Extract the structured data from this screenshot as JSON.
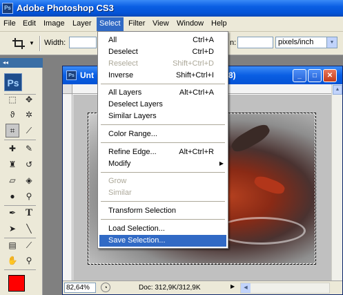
{
  "app": {
    "title": "Adobe Photoshop CS3",
    "ps_badge": "Ps"
  },
  "menubar": {
    "items": [
      "File",
      "Edit",
      "Image",
      "Layer",
      "Select",
      "Filter",
      "View",
      "Window",
      "Help"
    ],
    "active": "Select"
  },
  "options": {
    "width_label": "Width:",
    "res_label_tail": "n:",
    "unit": "pixels/inch"
  },
  "toolbox": {
    "collapse": "◂◂",
    "logo": "Ps",
    "foreground_color": "#ff0000"
  },
  "document": {
    "title_start": "Unt",
    "title_end": "8)",
    "zoom": "82,64%",
    "doc_info": "Doc: 312,9K/312,9K"
  },
  "select_menu": {
    "items": [
      {
        "label": "All",
        "shortcut": "Ctrl+A",
        "disabled": false
      },
      {
        "label": "Deselect",
        "shortcut": "Ctrl+D",
        "disabled": false
      },
      {
        "label": "Reselect",
        "shortcut": "Shift+Ctrl+D",
        "disabled": true
      },
      {
        "label": "Inverse",
        "shortcut": "Shift+Ctrl+I",
        "disabled": false
      },
      {
        "label": "All Layers",
        "shortcut": "Alt+Ctrl+A",
        "disabled": false
      },
      {
        "label": "Deselect Layers",
        "shortcut": "",
        "disabled": false
      },
      {
        "label": "Similar Layers",
        "shortcut": "",
        "disabled": false
      },
      {
        "label": "Color Range...",
        "shortcut": "",
        "disabled": false
      },
      {
        "label": "Refine Edge...",
        "shortcut": "Alt+Ctrl+R",
        "disabled": false
      },
      {
        "label": "Modify",
        "shortcut": "",
        "disabled": false,
        "submenu": true
      },
      {
        "label": "Grow",
        "shortcut": "",
        "disabled": true
      },
      {
        "label": "Similar",
        "shortcut": "",
        "disabled": true
      },
      {
        "label": "Transform Selection",
        "shortcut": "",
        "disabled": false
      },
      {
        "label": "Load Selection...",
        "shortcut": "",
        "disabled": false
      },
      {
        "label": "Save Selection...",
        "shortcut": "",
        "disabled": false,
        "highlighted": true
      }
    ]
  }
}
